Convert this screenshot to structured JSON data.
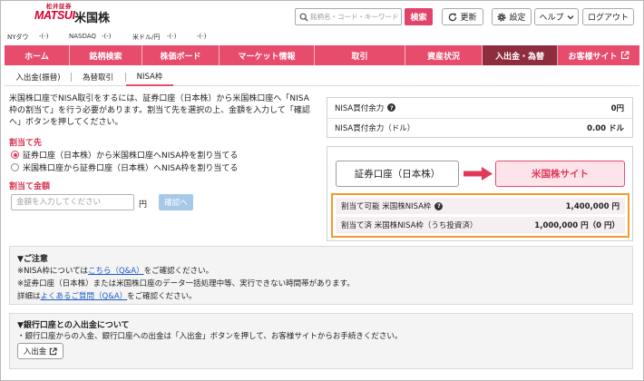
{
  "header": {
    "logo": {
      "company": "松井証券",
      "brand": "MATSUI",
      "product": "米国株"
    },
    "search": {
      "placeholder": "銘柄名・コード・キーワード",
      "icon": "search-icon"
    },
    "search_button": "検索",
    "refresh": {
      "label": "更新",
      "icon": "refresh-icon"
    },
    "settings": {
      "label": "設定",
      "icon": "gear-icon"
    },
    "help": {
      "label": "ヘルプ",
      "icon": "chevron-down-icon"
    },
    "logout": {
      "label": "ログアウト"
    }
  },
  "ticker": [
    {
      "label": "NYダウ",
      "value": "-(-)"
    },
    {
      "label": "NASDAQ",
      "value": "-(-)"
    },
    {
      "label": "米ドル/円",
      "value": "-(-)"
    },
    {
      "value": "-(-)"
    }
  ],
  "nav": {
    "items": [
      {
        "label": "ホーム"
      },
      {
        "label": "銘柄検索"
      },
      {
        "label": "株価ボード"
      },
      {
        "label": "マーケット情報"
      },
      {
        "label": "取引"
      },
      {
        "label": "資産状況"
      },
      {
        "label": "入出金・為替",
        "active": true
      },
      {
        "label": "お客様サイト",
        "icon": "external-link-icon"
      }
    ]
  },
  "subtabs": {
    "items": [
      {
        "label": "入出金(振替)"
      },
      {
        "label": "為替取引"
      },
      {
        "label": "NISA枠",
        "active": true
      }
    ]
  },
  "intro": {
    "lines": [
      "米国株口座でNISA取引をするには、証券口座（日本株）から米国株口座へ「NISA",
      "枠の割当て」を行う必要があります。割当て先を選択の上、金額を入力して「確認",
      "へ」ボタンを押してください。"
    ]
  },
  "target": {
    "heading": "割当て先",
    "options": [
      {
        "label": "証券口座（日本株）から米国株口座へNISA枠を割り当てる",
        "selected": true
      },
      {
        "label": "米国株口座から証券口座（日本株）へNISA枠を割り当てる",
        "selected": false
      }
    ]
  },
  "amount": {
    "heading": "割当て金額",
    "placeholder": "金額を入力してください",
    "unit": "円",
    "confirm_button": "確認へ"
  },
  "buying_power": [
    {
      "label": "NISA買付余力",
      "value": "0円",
      "icon": "help-icon"
    },
    {
      "label": "NISA買付余力（ドル）",
      "value": "0.00 ドル"
    }
  ],
  "direction": {
    "from": "証券口座（日本株）",
    "to": "米国株サイト",
    "icon": "arrow-right-icon"
  },
  "quota": [
    {
      "label": "割当て可能 米国株NISA枠",
      "value": "1,400,000 円",
      "icon": "help-icon"
    },
    {
      "label": "割当て済 米国株NISA枠（うち投資済）",
      "value": "1,000,000 円（0 円）"
    }
  ],
  "notice": {
    "heading": "▼ご注意",
    "line1": {
      "pre": "※NISA枠については",
      "link": "こちら（Q&A）",
      "post": "をご確認ください。"
    },
    "line2": "※証券口座（日本株）または米国株口座のデータ一括処理中等、実行できない時間帯があります。",
    "line3": {
      "pre": "詳細は",
      "link": "よくあるご質問（Q&A）",
      "post": "をご確認ください。"
    }
  },
  "bank": {
    "heading": "▼銀行口座との入出金について",
    "text": "・銀行口座からの入金、銀行口座への出金は「入出金」ボタンを押して、お客様サイトからお手続きください。",
    "button": {
      "label": "入出金",
      "icon": "external-link-icon"
    }
  },
  "colors": {
    "nav": "#e84c6c",
    "nav_active": "#8e2d3d",
    "accent": "#e03a5a",
    "highlight_border": "#f29a2e",
    "link": "#1a5ac8",
    "confirm_button": "#a6c9e8"
  }
}
